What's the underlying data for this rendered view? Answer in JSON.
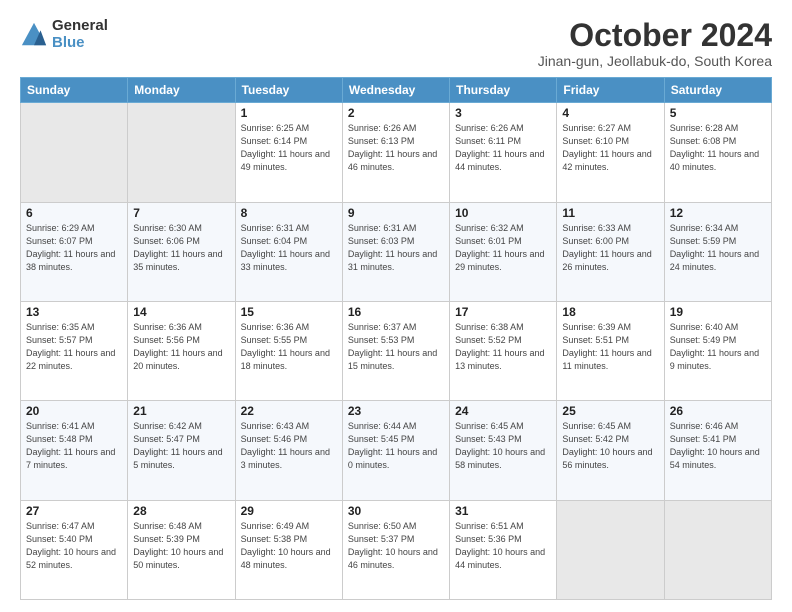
{
  "logo": {
    "general": "General",
    "blue": "Blue"
  },
  "header": {
    "month": "October 2024",
    "location": "Jinan-gun, Jeollabuk-do, South Korea"
  },
  "days_of_week": [
    "Sunday",
    "Monday",
    "Tuesday",
    "Wednesday",
    "Thursday",
    "Friday",
    "Saturday"
  ],
  "weeks": [
    [
      {
        "day": "",
        "info": ""
      },
      {
        "day": "",
        "info": ""
      },
      {
        "day": "1",
        "info": "Sunrise: 6:25 AM\nSunset: 6:14 PM\nDaylight: 11 hours\nand 49 minutes."
      },
      {
        "day": "2",
        "info": "Sunrise: 6:26 AM\nSunset: 6:13 PM\nDaylight: 11 hours\nand 46 minutes."
      },
      {
        "day": "3",
        "info": "Sunrise: 6:26 AM\nSunset: 6:11 PM\nDaylight: 11 hours\nand 44 minutes."
      },
      {
        "day": "4",
        "info": "Sunrise: 6:27 AM\nSunset: 6:10 PM\nDaylight: 11 hours\nand 42 minutes."
      },
      {
        "day": "5",
        "info": "Sunrise: 6:28 AM\nSunset: 6:08 PM\nDaylight: 11 hours\nand 40 minutes."
      }
    ],
    [
      {
        "day": "6",
        "info": "Sunrise: 6:29 AM\nSunset: 6:07 PM\nDaylight: 11 hours\nand 38 minutes."
      },
      {
        "day": "7",
        "info": "Sunrise: 6:30 AM\nSunset: 6:06 PM\nDaylight: 11 hours\nand 35 minutes."
      },
      {
        "day": "8",
        "info": "Sunrise: 6:31 AM\nSunset: 6:04 PM\nDaylight: 11 hours\nand 33 minutes."
      },
      {
        "day": "9",
        "info": "Sunrise: 6:31 AM\nSunset: 6:03 PM\nDaylight: 11 hours\nand 31 minutes."
      },
      {
        "day": "10",
        "info": "Sunrise: 6:32 AM\nSunset: 6:01 PM\nDaylight: 11 hours\nand 29 minutes."
      },
      {
        "day": "11",
        "info": "Sunrise: 6:33 AM\nSunset: 6:00 PM\nDaylight: 11 hours\nand 26 minutes."
      },
      {
        "day": "12",
        "info": "Sunrise: 6:34 AM\nSunset: 5:59 PM\nDaylight: 11 hours\nand 24 minutes."
      }
    ],
    [
      {
        "day": "13",
        "info": "Sunrise: 6:35 AM\nSunset: 5:57 PM\nDaylight: 11 hours\nand 22 minutes."
      },
      {
        "day": "14",
        "info": "Sunrise: 6:36 AM\nSunset: 5:56 PM\nDaylight: 11 hours\nand 20 minutes."
      },
      {
        "day": "15",
        "info": "Sunrise: 6:36 AM\nSunset: 5:55 PM\nDaylight: 11 hours\nand 18 minutes."
      },
      {
        "day": "16",
        "info": "Sunrise: 6:37 AM\nSunset: 5:53 PM\nDaylight: 11 hours\nand 15 minutes."
      },
      {
        "day": "17",
        "info": "Sunrise: 6:38 AM\nSunset: 5:52 PM\nDaylight: 11 hours\nand 13 minutes."
      },
      {
        "day": "18",
        "info": "Sunrise: 6:39 AM\nSunset: 5:51 PM\nDaylight: 11 hours\nand 11 minutes."
      },
      {
        "day": "19",
        "info": "Sunrise: 6:40 AM\nSunset: 5:49 PM\nDaylight: 11 hours\nand 9 minutes."
      }
    ],
    [
      {
        "day": "20",
        "info": "Sunrise: 6:41 AM\nSunset: 5:48 PM\nDaylight: 11 hours\nand 7 minutes."
      },
      {
        "day": "21",
        "info": "Sunrise: 6:42 AM\nSunset: 5:47 PM\nDaylight: 11 hours\nand 5 minutes."
      },
      {
        "day": "22",
        "info": "Sunrise: 6:43 AM\nSunset: 5:46 PM\nDaylight: 11 hours\nand 3 minutes."
      },
      {
        "day": "23",
        "info": "Sunrise: 6:44 AM\nSunset: 5:45 PM\nDaylight: 11 hours\nand 0 minutes."
      },
      {
        "day": "24",
        "info": "Sunrise: 6:45 AM\nSunset: 5:43 PM\nDaylight: 10 hours\nand 58 minutes."
      },
      {
        "day": "25",
        "info": "Sunrise: 6:45 AM\nSunset: 5:42 PM\nDaylight: 10 hours\nand 56 minutes."
      },
      {
        "day": "26",
        "info": "Sunrise: 6:46 AM\nSunset: 5:41 PM\nDaylight: 10 hours\nand 54 minutes."
      }
    ],
    [
      {
        "day": "27",
        "info": "Sunrise: 6:47 AM\nSunset: 5:40 PM\nDaylight: 10 hours\nand 52 minutes."
      },
      {
        "day": "28",
        "info": "Sunrise: 6:48 AM\nSunset: 5:39 PM\nDaylight: 10 hours\nand 50 minutes."
      },
      {
        "day": "29",
        "info": "Sunrise: 6:49 AM\nSunset: 5:38 PM\nDaylight: 10 hours\nand 48 minutes."
      },
      {
        "day": "30",
        "info": "Sunrise: 6:50 AM\nSunset: 5:37 PM\nDaylight: 10 hours\nand 46 minutes."
      },
      {
        "day": "31",
        "info": "Sunrise: 6:51 AM\nSunset: 5:36 PM\nDaylight: 10 hours\nand 44 minutes."
      },
      {
        "day": "",
        "info": ""
      },
      {
        "day": "",
        "info": ""
      }
    ]
  ]
}
